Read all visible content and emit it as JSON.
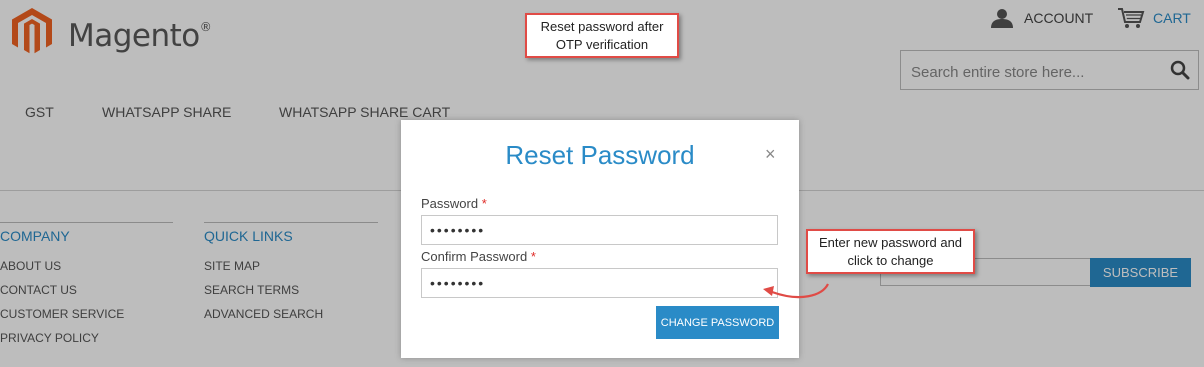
{
  "header": {
    "brand": "Magento",
    "brand_mark": "®",
    "account_label": "ACCOUNT",
    "cart_label": "CART",
    "search_placeholder": "Search entire store here..."
  },
  "nav": {
    "items": [
      {
        "label": "GST"
      },
      {
        "label": "WHATSAPP SHARE"
      },
      {
        "label": "WHATSAPP SHARE CART"
      }
    ]
  },
  "footer": {
    "columns": [
      {
        "title": "COMPANY",
        "links": [
          "ABOUT US",
          "CONTACT US",
          "CUSTOMER SERVICE",
          "PRIVACY POLICY"
        ]
      },
      {
        "title": "QUICK LINKS",
        "links": [
          "SITE MAP",
          "SEARCH TERMS",
          "ADVANCED SEARCH"
        ]
      }
    ],
    "subscribe_label": "SUBSCRIBE"
  },
  "modal": {
    "title": "Reset Password",
    "close": "×",
    "password_label": "Password",
    "password_value": "••••••••",
    "confirm_label": "Confirm Password",
    "confirm_value": "••••••••",
    "required_mark": "*",
    "submit_label": "CHANGE PASSWORD"
  },
  "annotations": {
    "top_line1": "Reset password after",
    "top_line2": "OTP verification",
    "side_line1": "Enter new password and",
    "side_line2": "click to change"
  },
  "colors": {
    "accent": "#2a8bc7",
    "logo_orange": "#f26322",
    "callout_border": "#e04b46",
    "required": "#e02b27"
  }
}
